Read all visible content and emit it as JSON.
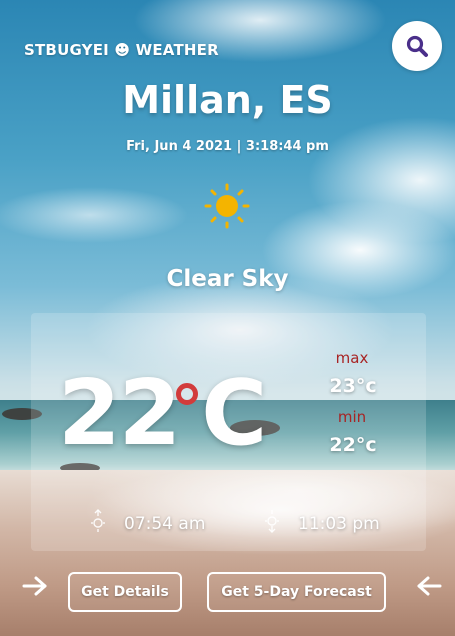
{
  "header": {
    "brand": "STBUGYEI ☻ WEATHER"
  },
  "location": {
    "city": "Millan, ES",
    "datetime": "Fri, Jun 4 2021 | 3:18:44 pm"
  },
  "weather": {
    "condition": "Clear Sky",
    "temperature": "22",
    "unit": "C",
    "max_label": "max",
    "max_value": "23°c",
    "min_label": "min",
    "min_value": "22°c",
    "sunrise": "07:54 am",
    "sunset": "11:03 pm",
    "icon": "sun-icon"
  },
  "actions": {
    "details_label": "Get Details",
    "forecast_label": "Get 5-Day Forecast"
  },
  "colors": {
    "accent": "#a82424",
    "degree": "#d23b3b",
    "search_icon": "#4a2f8a",
    "sun": "#f4b400"
  }
}
